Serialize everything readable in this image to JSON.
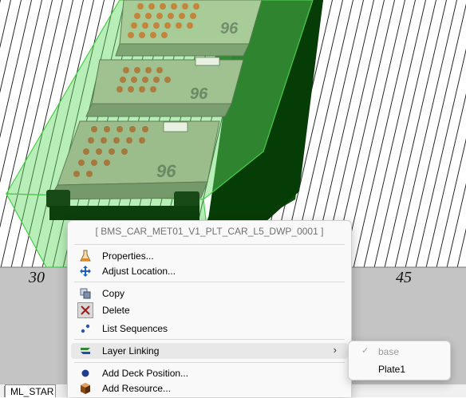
{
  "deck": {
    "position_labels": [
      "30",
      "45"
    ],
    "plate_labels": [
      "96",
      "96",
      "96"
    ]
  },
  "tab": {
    "label": "ML_STAR"
  },
  "context_menu": {
    "header": "[ BMS_CAR_MET01_V1_PLT_CAR_L5_DWP_0001 ]",
    "items": [
      {
        "label": "Properties...",
        "icon": "flask-icon"
      },
      {
        "label": "Adjust Location...",
        "icon": "move-arrows-icon"
      },
      {
        "label": "Copy",
        "icon": "copy-icon"
      },
      {
        "label": "Delete",
        "icon": "delete-x-icon"
      },
      {
        "label": "List Sequences",
        "icon": "sequence-dots-icon"
      },
      {
        "label": "Layer Linking",
        "icon": "layer-link-icon",
        "has_submenu": true,
        "highlighted": true
      },
      {
        "label": "Add Deck Position...",
        "icon": "blue-dot-icon"
      },
      {
        "label": "Add Resource...",
        "icon": "box-icon"
      }
    ]
  },
  "layer_submenu": {
    "items": [
      {
        "label": "base",
        "checked": true,
        "disabled": true
      },
      {
        "label": "Plate1",
        "checked": false,
        "disabled": false
      }
    ]
  },
  "colors": {
    "carrier_green": "#0a5a0a",
    "highlight_green": "#6ee06e",
    "plate_body": "#a8c89a",
    "well_orange": "#c8782a",
    "deck_gray": "#c4c4c4",
    "menu_bg": "#f9f9f9"
  }
}
